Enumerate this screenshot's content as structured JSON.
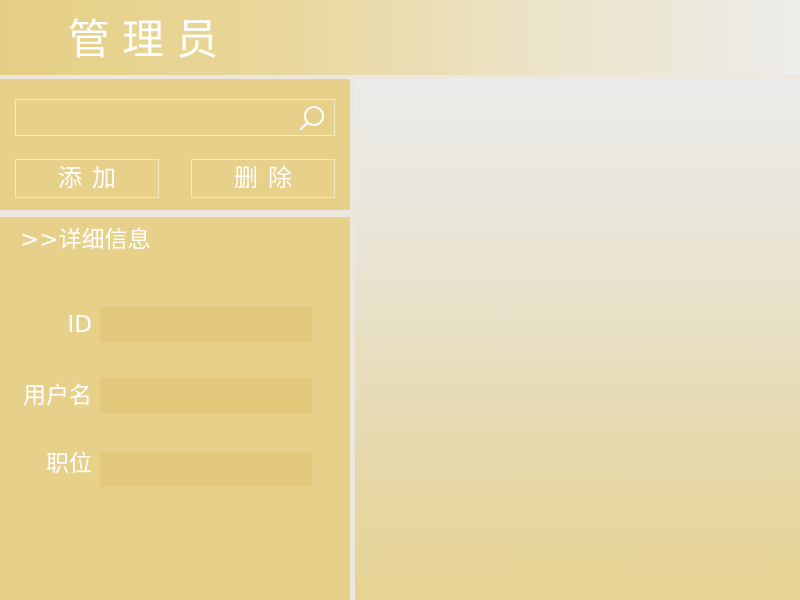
{
  "header": {
    "title": "管理员"
  },
  "search": {
    "value": "",
    "placeholder": "",
    "icon": "search-icon"
  },
  "actions": {
    "add_label": "添加",
    "delete_label": "删除"
  },
  "detail": {
    "heading": ">>详细信息",
    "fields": [
      {
        "label": "ID",
        "value": ""
      },
      {
        "label": "用户名",
        "value": ""
      },
      {
        "label": "职位",
        "value": ""
      }
    ]
  },
  "colors": {
    "accent": "#e6d08a",
    "field_bg": "#e3c97b",
    "text": "#ffffff"
  }
}
